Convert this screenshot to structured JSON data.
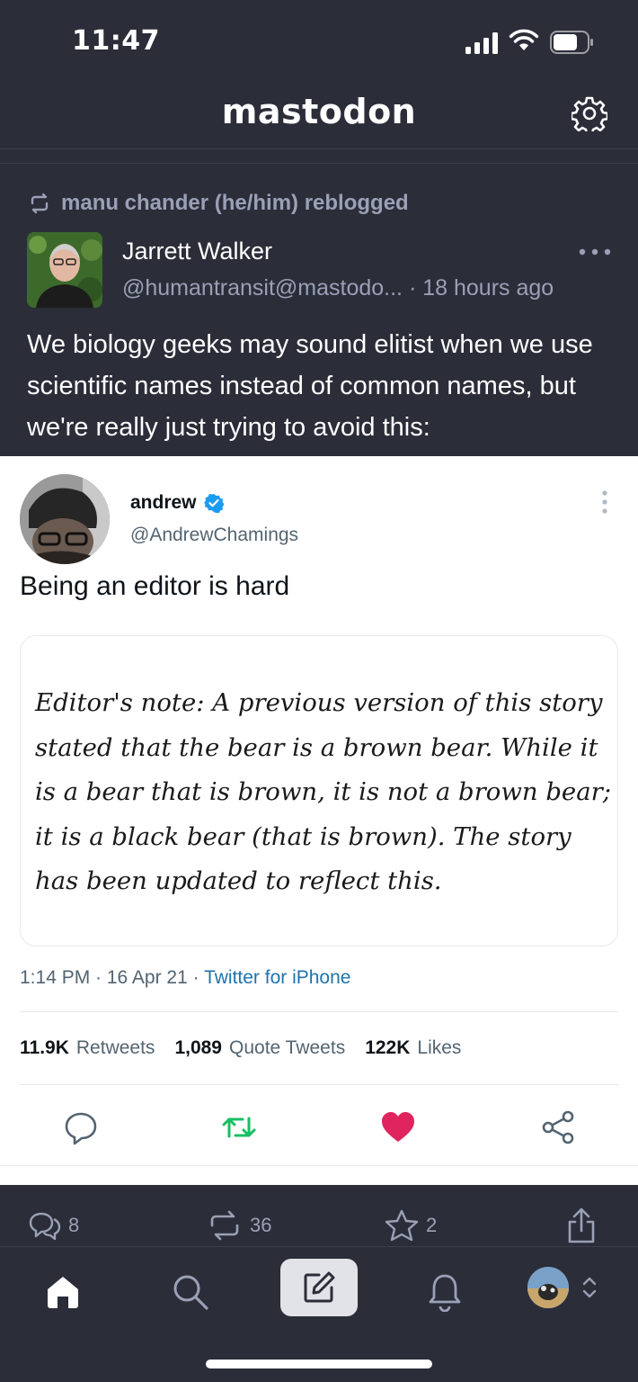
{
  "status_bar": {
    "time": "11:47"
  },
  "header": {
    "title": "mastodon",
    "settings_icon": "gear-icon"
  },
  "toot": {
    "reblog_text": "manu chander (he/him) reblogged",
    "author_name": "Jarrett Walker",
    "author_handle": "@humantransit@mastodo...",
    "timestamp": "· 18 hours ago",
    "content": "We biology geeks may sound elitist when we use scientific names instead of common names, but we're really just trying to avoid this:",
    "actions": {
      "replies": "8",
      "reblogs": "36",
      "favourites": "2"
    }
  },
  "embedded_tweet": {
    "name": "andrew",
    "handle": "@AndrewChamings",
    "text": "Being an editor is hard",
    "quote": "Editor's note: A previous version of this story stated that the bear is a brown bear. While it is a bear that is brown, it is not a brown bear; it is a black bear (that is brown). The story has been updated to reflect this.",
    "time_date": "1:14 PM · 16 Apr 21 · ",
    "source": "Twitter for iPhone",
    "stats": {
      "retweets_count": "11.9K",
      "retweets_label": "Retweets",
      "quotes_count": "1,089",
      "quotes_label": "Quote Tweets",
      "likes_count": "122K",
      "likes_label": "Likes"
    },
    "colors": {
      "verified": "#1d9bf0",
      "retweet": "#17bf63",
      "like": "#e0245e"
    }
  },
  "tab_bar": {
    "tabs": [
      "home-icon",
      "search-icon",
      "compose-icon",
      "bell-icon",
      "profile-avatar"
    ]
  }
}
